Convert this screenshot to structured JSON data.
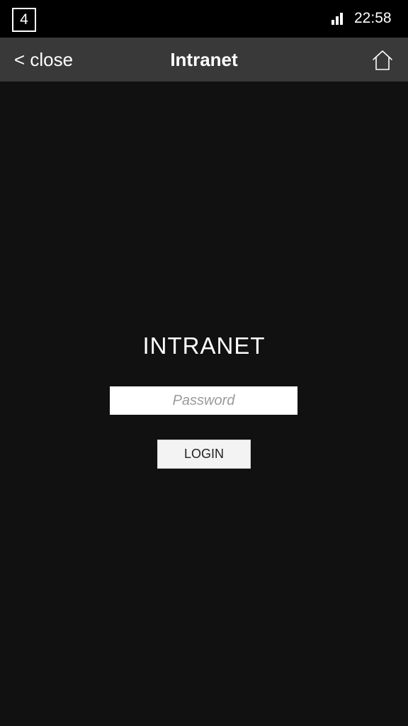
{
  "status_bar": {
    "notification_count": "4",
    "signal_icon": "signal-bars-icon",
    "time": "22:58"
  },
  "nav": {
    "close_label": "< close",
    "title": "Intranet",
    "home_icon": "home-icon"
  },
  "login": {
    "heading": "INTRANET",
    "password_placeholder": "Password",
    "password_value": "",
    "button_label": "LOGIN"
  },
  "colors": {
    "background": "#111111",
    "status_bar": "#000000",
    "nav_bar": "#393939",
    "text": "#ffffff",
    "button": "#f3f3f3"
  }
}
